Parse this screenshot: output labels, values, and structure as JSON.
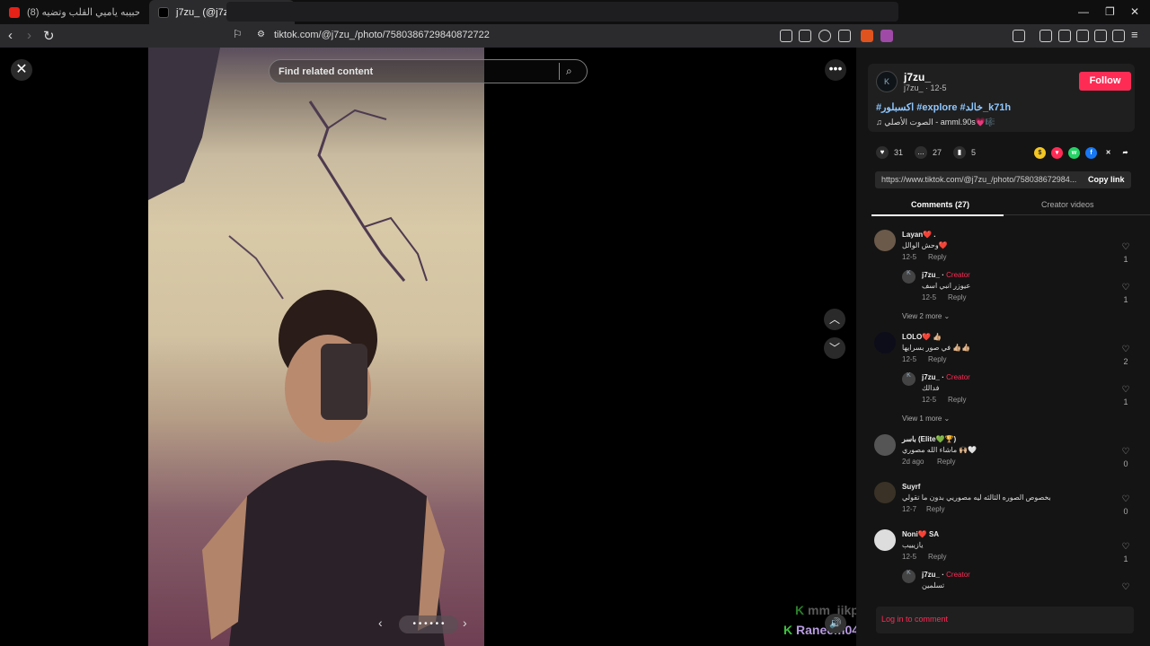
{
  "browser": {
    "tabs": [
      {
        "title": "(8) حدثيني ياحبيبه ياميي القلب وتضيه..."
      },
      {
        "title": "j7zu_ (@j7zu_) | TikTok"
      }
    ],
    "url": "tiktok.com/@j7zu_/photo/7580386729840872722"
  },
  "player": {
    "search_placeholder": "Find related content",
    "pager": "• • • • • •",
    "overlay_names": [
      "mm_iikp 4_ii81",
      "Raneem04"
    ]
  },
  "post": {
    "author": "j7zu_",
    "author_meta": "j7zu_ · 12-5",
    "follow_label": "Follow",
    "hashtags": "#اكسبلور #explore #خالد_k71h",
    "music": "♫ الصوت الأصلي - amml.90s💗🎼",
    "likes": "31",
    "comments": "27",
    "saves": "5",
    "link": "https://www.tiktok.com/@j7zu_/photo/758038672984...",
    "copy_label": "Copy link"
  },
  "tabs": {
    "comments": "Comments (27)",
    "creator": "Creator videos"
  },
  "comments": [
    {
      "name": "Layan❤️ .",
      "text": "وحش الوالل❤️",
      "date": "12-5",
      "reply": "Reply",
      "likes": "1"
    },
    {
      "name": "j7zu_ ·",
      "creator": "Creator",
      "text": "عيوزر انبي اسف",
      "date": "12-5",
      "reply": "Reply",
      "likes": "1"
    },
    {
      "viewmore": "View 2 more ⌄"
    },
    {
      "name": "LOLO❤️ 👍🏼",
      "text": "في صور بسرايها 👍🏼👍🏼",
      "date": "12-5",
      "reply": "Reply",
      "likes": "2"
    },
    {
      "name": "j7zu_ ·",
      "creator": "Creator",
      "text": "فدالك",
      "date": "12-5",
      "reply": "Reply",
      "likes": "1"
    },
    {
      "viewmore": "View 1 more ⌄"
    },
    {
      "name": "باسر (Elite💚🏆)",
      "text": "ماشاء الله مصوري 🙌🏼🤍",
      "date": "2d ago",
      "reply": "Reply",
      "likes": "0"
    },
    {
      "name": "Suyrf",
      "text": "بخصوص الصوره الثالثه ليه مصوريي بدون ما تقولي",
      "date": "12-7",
      "reply": "Reply",
      "likes": "0"
    },
    {
      "name": "Noni❤️ SA",
      "text": "يازيييب",
      "date": "12-5",
      "reply": "Reply",
      "likes": "1"
    },
    {
      "name": "j7zu_ ·",
      "creator": "Creator",
      "text": "تسلمين",
      "date": "",
      "reply": "",
      "likes": ""
    }
  ],
  "login": "Log in to comment"
}
